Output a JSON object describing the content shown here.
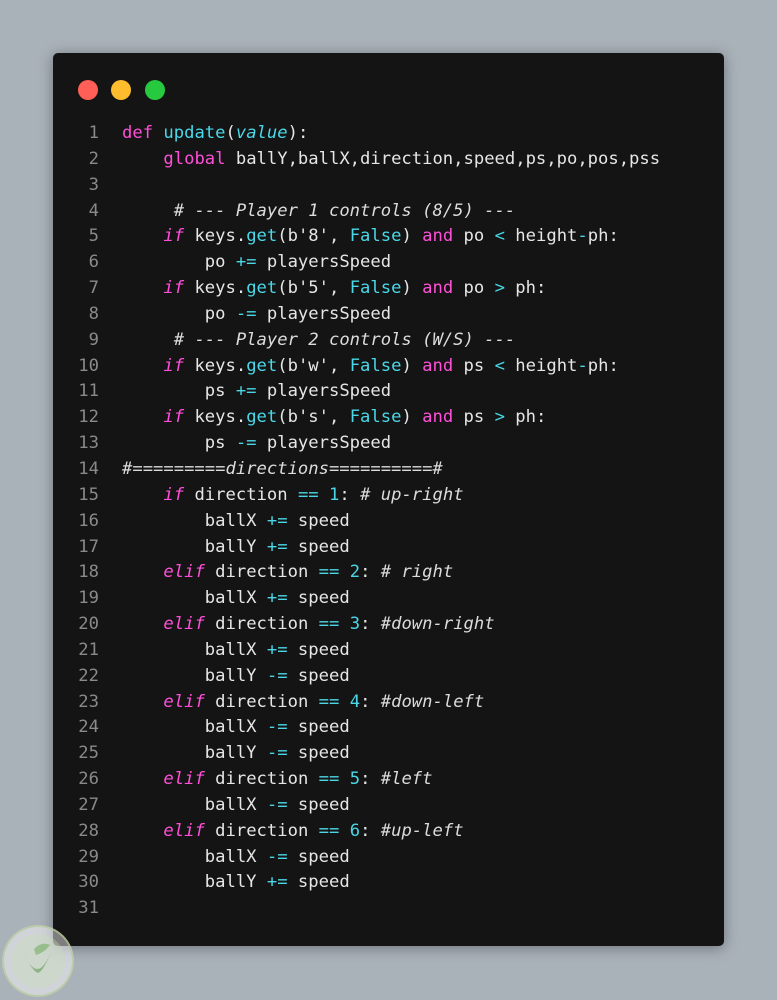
{
  "window": {
    "controls": {
      "close": "#ff5f56",
      "minimize": "#ffbd2e",
      "maximize": "#27c93f"
    },
    "background": "#141414"
  },
  "colors": {
    "keyword": "#ff4fd8",
    "function": "#4ad8e8",
    "text": "#e6e6e6",
    "line_number": "#8a8a8a"
  },
  "code": {
    "line_numbers": [
      "1",
      "2",
      "3",
      "4",
      "5",
      "6",
      "7",
      "8",
      "9",
      "10",
      "11",
      "12",
      "13",
      "14",
      "15",
      "16",
      "17",
      "18",
      "19",
      "20",
      "21",
      "22",
      "23",
      "24",
      "25",
      "26",
      "27",
      "28",
      "29",
      "30",
      "31"
    ],
    "lines": [
      [
        {
          "t": "kw",
          "v": "def"
        },
        {
          "t": "",
          "v": " "
        },
        {
          "t": "fn",
          "v": "update"
        },
        {
          "t": "",
          "v": "("
        },
        {
          "t": "param",
          "v": "value"
        },
        {
          "t": "",
          "v": "):"
        }
      ],
      [
        {
          "t": "",
          "v": "    "
        },
        {
          "t": "kw",
          "v": "global"
        },
        {
          "t": "",
          "v": " ballY,ballX,direction,speed,ps,po,pos,pss"
        }
      ],
      [],
      [
        {
          "t": "",
          "v": "     "
        },
        {
          "t": "cm",
          "v": "# --- Player 1 controls (8/5) ---"
        }
      ],
      [
        {
          "t": "",
          "v": "    "
        },
        {
          "t": "kwi",
          "v": "if"
        },
        {
          "t": "",
          "v": " keys."
        },
        {
          "t": "fn",
          "v": "get"
        },
        {
          "t": "",
          "v": "(b'8', "
        },
        {
          "t": "fn",
          "v": "False"
        },
        {
          "t": "",
          "v": ") "
        },
        {
          "t": "kw",
          "v": "and"
        },
        {
          "t": "",
          "v": " po "
        },
        {
          "t": "op",
          "v": "<"
        },
        {
          "t": "",
          "v": " height"
        },
        {
          "t": "op",
          "v": "-"
        },
        {
          "t": "",
          "v": "ph:"
        }
      ],
      [
        {
          "t": "",
          "v": "        po "
        },
        {
          "t": "op",
          "v": "+="
        },
        {
          "t": "",
          "v": " playersSpeed"
        }
      ],
      [
        {
          "t": "",
          "v": "    "
        },
        {
          "t": "kwi",
          "v": "if"
        },
        {
          "t": "",
          "v": " keys."
        },
        {
          "t": "fn",
          "v": "get"
        },
        {
          "t": "",
          "v": "(b'5', "
        },
        {
          "t": "fn",
          "v": "False"
        },
        {
          "t": "",
          "v": ") "
        },
        {
          "t": "kw",
          "v": "and"
        },
        {
          "t": "",
          "v": " po "
        },
        {
          "t": "op",
          "v": ">"
        },
        {
          "t": "",
          "v": " ph:"
        }
      ],
      [
        {
          "t": "",
          "v": "        po "
        },
        {
          "t": "op",
          "v": "-="
        },
        {
          "t": "",
          "v": " playersSpeed"
        }
      ],
      [
        {
          "t": "",
          "v": "     "
        },
        {
          "t": "cm",
          "v": "# --- Player 2 controls (W/S) ---"
        }
      ],
      [
        {
          "t": "",
          "v": "    "
        },
        {
          "t": "kwi",
          "v": "if"
        },
        {
          "t": "",
          "v": " keys."
        },
        {
          "t": "fn",
          "v": "get"
        },
        {
          "t": "",
          "v": "(b'w', "
        },
        {
          "t": "fn",
          "v": "False"
        },
        {
          "t": "",
          "v": ") "
        },
        {
          "t": "kw",
          "v": "and"
        },
        {
          "t": "",
          "v": " ps "
        },
        {
          "t": "op",
          "v": "<"
        },
        {
          "t": "",
          "v": " height"
        },
        {
          "t": "op",
          "v": "-"
        },
        {
          "t": "",
          "v": "ph:"
        }
      ],
      [
        {
          "t": "",
          "v": "        ps "
        },
        {
          "t": "op",
          "v": "+="
        },
        {
          "t": "",
          "v": " playersSpeed"
        }
      ],
      [
        {
          "t": "",
          "v": "    "
        },
        {
          "t": "kwi",
          "v": "if"
        },
        {
          "t": "",
          "v": " keys."
        },
        {
          "t": "fn",
          "v": "get"
        },
        {
          "t": "",
          "v": "(b's', "
        },
        {
          "t": "fn",
          "v": "False"
        },
        {
          "t": "",
          "v": ") "
        },
        {
          "t": "kw",
          "v": "and"
        },
        {
          "t": "",
          "v": " ps "
        },
        {
          "t": "op",
          "v": ">"
        },
        {
          "t": "",
          "v": " ph:"
        }
      ],
      [
        {
          "t": "",
          "v": "        ps "
        },
        {
          "t": "op",
          "v": "-="
        },
        {
          "t": "",
          "v": " playersSpeed"
        }
      ],
      [
        {
          "t": "cm",
          "v": "#=========directions==========#"
        }
      ],
      [
        {
          "t": "",
          "v": "    "
        },
        {
          "t": "kwi",
          "v": "if"
        },
        {
          "t": "",
          "v": " direction "
        },
        {
          "t": "op",
          "v": "=="
        },
        {
          "t": "",
          "v": " "
        },
        {
          "t": "num",
          "v": "1"
        },
        {
          "t": "",
          "v": ": "
        },
        {
          "t": "cm",
          "v": "# up-right"
        }
      ],
      [
        {
          "t": "",
          "v": "        ballX "
        },
        {
          "t": "op",
          "v": "+="
        },
        {
          "t": "",
          "v": " speed"
        }
      ],
      [
        {
          "t": "",
          "v": "        ballY "
        },
        {
          "t": "op",
          "v": "+="
        },
        {
          "t": "",
          "v": " speed"
        }
      ],
      [
        {
          "t": "",
          "v": "    "
        },
        {
          "t": "kwi",
          "v": "elif"
        },
        {
          "t": "",
          "v": " direction "
        },
        {
          "t": "op",
          "v": "=="
        },
        {
          "t": "",
          "v": " "
        },
        {
          "t": "num",
          "v": "2"
        },
        {
          "t": "",
          "v": ": "
        },
        {
          "t": "cm",
          "v": "# right"
        }
      ],
      [
        {
          "t": "",
          "v": "        ballX "
        },
        {
          "t": "op",
          "v": "+="
        },
        {
          "t": "",
          "v": " speed"
        }
      ],
      [
        {
          "t": "",
          "v": "    "
        },
        {
          "t": "kwi",
          "v": "elif"
        },
        {
          "t": "",
          "v": " direction "
        },
        {
          "t": "op",
          "v": "=="
        },
        {
          "t": "",
          "v": " "
        },
        {
          "t": "num",
          "v": "3"
        },
        {
          "t": "",
          "v": ": "
        },
        {
          "t": "cm",
          "v": "#down-right"
        }
      ],
      [
        {
          "t": "",
          "v": "        ballX "
        },
        {
          "t": "op",
          "v": "+="
        },
        {
          "t": "",
          "v": " speed"
        }
      ],
      [
        {
          "t": "",
          "v": "        ballY "
        },
        {
          "t": "op",
          "v": "-="
        },
        {
          "t": "",
          "v": " speed"
        }
      ],
      [
        {
          "t": "",
          "v": "    "
        },
        {
          "t": "kwi",
          "v": "elif"
        },
        {
          "t": "",
          "v": " direction "
        },
        {
          "t": "op",
          "v": "=="
        },
        {
          "t": "",
          "v": " "
        },
        {
          "t": "num",
          "v": "4"
        },
        {
          "t": "",
          "v": ": "
        },
        {
          "t": "cm",
          "v": "#down-left"
        }
      ],
      [
        {
          "t": "",
          "v": "        ballX "
        },
        {
          "t": "op",
          "v": "-="
        },
        {
          "t": "",
          "v": " speed"
        }
      ],
      [
        {
          "t": "",
          "v": "        ballY "
        },
        {
          "t": "op",
          "v": "-="
        },
        {
          "t": "",
          "v": " speed"
        }
      ],
      [
        {
          "t": "",
          "v": "    "
        },
        {
          "t": "kwi",
          "v": "elif"
        },
        {
          "t": "",
          "v": " direction "
        },
        {
          "t": "op",
          "v": "=="
        },
        {
          "t": "",
          "v": " "
        },
        {
          "t": "num",
          "v": "5"
        },
        {
          "t": "",
          "v": ": "
        },
        {
          "t": "cm",
          "v": "#left"
        }
      ],
      [
        {
          "t": "",
          "v": "        ballX "
        },
        {
          "t": "op",
          "v": "-="
        },
        {
          "t": "",
          "v": " speed"
        }
      ],
      [
        {
          "t": "",
          "v": "    "
        },
        {
          "t": "kwi",
          "v": "elif"
        },
        {
          "t": "",
          "v": " direction "
        },
        {
          "t": "op",
          "v": "=="
        },
        {
          "t": "",
          "v": " "
        },
        {
          "t": "num",
          "v": "6"
        },
        {
          "t": "",
          "v": ": "
        },
        {
          "t": "cm",
          "v": "#up-left"
        }
      ],
      [
        {
          "t": "",
          "v": "        ballX "
        },
        {
          "t": "op",
          "v": "-="
        },
        {
          "t": "",
          "v": " speed"
        }
      ],
      [
        {
          "t": "",
          "v": "        ballY "
        },
        {
          "t": "op",
          "v": "+="
        },
        {
          "t": "",
          "v": " speed"
        }
      ],
      []
    ]
  },
  "watermark": {
    "icon": "leaf-logo-icon"
  }
}
